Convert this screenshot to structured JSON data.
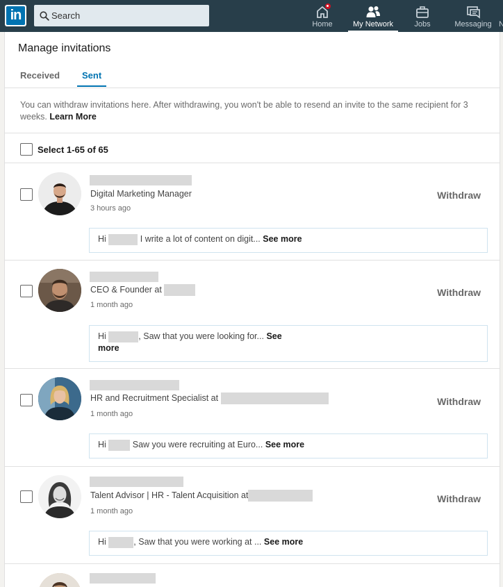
{
  "nav": {
    "search_placeholder": "Search",
    "items": [
      {
        "label": "Home",
        "icon": "home-icon"
      },
      {
        "label": "My Network",
        "icon": "network-icon"
      },
      {
        "label": "Jobs",
        "icon": "briefcase-icon"
      },
      {
        "label": "Messaging",
        "icon": "messaging-icon"
      },
      {
        "label": "N",
        "icon": ""
      }
    ],
    "colors": {
      "bar": "#283e4a",
      "brand": "#0073b1",
      "badge": "#d11124"
    }
  },
  "page": {
    "title": "Manage invitations",
    "tabs": [
      {
        "label": "Received"
      },
      {
        "label": "Sent"
      }
    ],
    "notice_text": "You can withdraw invitations here. After withdrawing, you won't be able to resend an invite to the same recipient for 3 weeks.",
    "notice_link": "Learn More",
    "select_all": "Select 1-65 of 65",
    "withdraw_label": "Withdraw",
    "see_more": "See more"
  },
  "invitations": [
    {
      "headline": "Digital Marketing Manager",
      "time": "3 hours ago",
      "msg_pre": "Hi",
      "msg_post": " I write a lot of content on digit...",
      "see_more": "See more"
    },
    {
      "headline": "CEO & Founder at",
      "time": "1 month ago",
      "msg_pre": "Hi",
      "msg_post": ", Saw that you were looking for...",
      "see_more_a": "See",
      "see_more_b": "more"
    },
    {
      "headline": "HR and Recruitment Specialist at",
      "time": "1 month ago",
      "msg_pre": "Hi",
      "msg_post": " Saw you were recruiting at Euro...",
      "see_more": "See more"
    },
    {
      "headline": "Talent Advisor | HR - Talent Acquisition at",
      "time": "1 month ago",
      "msg_pre": "Hi",
      "msg_post": ", Saw that you were working at ...",
      "see_more": "See more"
    }
  ]
}
